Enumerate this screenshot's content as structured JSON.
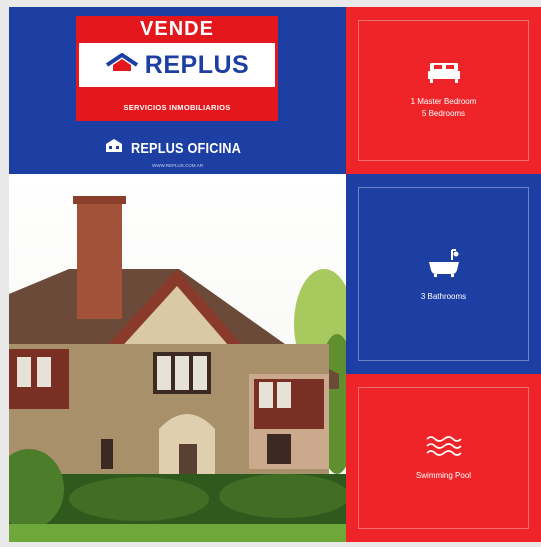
{
  "brand": {
    "top_label": "VENDE",
    "wordmark": "REPLUS",
    "tagline": "SERVICIOS INMOBILIARIOS",
    "office_name": "REPLUS OFICINA",
    "website": "WWW.REPLUS.COM.AR"
  },
  "features": [
    {
      "icon": "bed-icon",
      "line1": "1 Master Bedroom",
      "line2": "5 Bedrooms",
      "color": "#ee2429"
    },
    {
      "icon": "bathtub-icon",
      "line1": "3 Bathrooms",
      "line2": "",
      "color": "#1d3fa4"
    },
    {
      "icon": "pool-waves-icon",
      "line1": "Swimming Pool",
      "line2": "",
      "color": "#ee2429"
    }
  ],
  "colors": {
    "brand_blue": "#1d3fa4",
    "brand_red": "#e3171c"
  }
}
